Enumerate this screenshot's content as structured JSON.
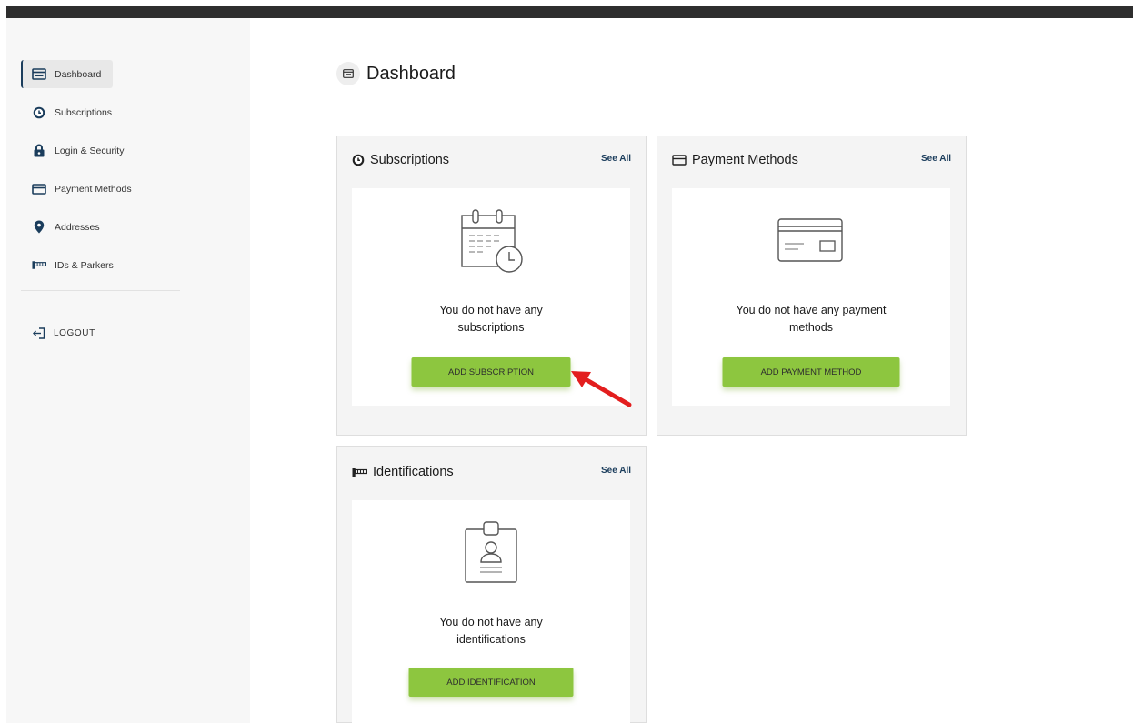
{
  "sidebar": {
    "items": [
      {
        "label": "Dashboard",
        "icon": "dashboard-icon",
        "active": true
      },
      {
        "label": "Subscriptions",
        "icon": "clock-icon"
      },
      {
        "label": "Login & Security",
        "icon": "lock-icon"
      },
      {
        "label": "Payment Methods",
        "icon": "credit-card-icon"
      },
      {
        "label": "Addresses",
        "icon": "map-pin-icon"
      },
      {
        "label": "IDs & Parkers",
        "icon": "id-tag-icon"
      }
    ],
    "logout": {
      "label": "LOGOUT",
      "icon": "logout-icon"
    }
  },
  "main": {
    "title": "Dashboard",
    "cards": [
      {
        "title": "Subscriptions",
        "see_all": "See All",
        "message_line1": "You do not have any",
        "message_line2": "subscriptions",
        "button": "ADD SUBSCRIPTION"
      },
      {
        "title": "Payment Methods",
        "see_all": "See All",
        "message_line1": "You do not have any payment",
        "message_line2": "methods",
        "button": "ADD PAYMENT METHOD"
      },
      {
        "title": "Identifications",
        "see_all": "See All",
        "message_line1": "You do not have any",
        "message_line2": "identifications",
        "button": "ADD IDENTIFICATION"
      }
    ]
  },
  "colors": {
    "accent_green": "#8dc63f",
    "navy": "#1b3d5c",
    "annotation_red": "#e31e1e",
    "topbar": "#2e2e2e"
  }
}
